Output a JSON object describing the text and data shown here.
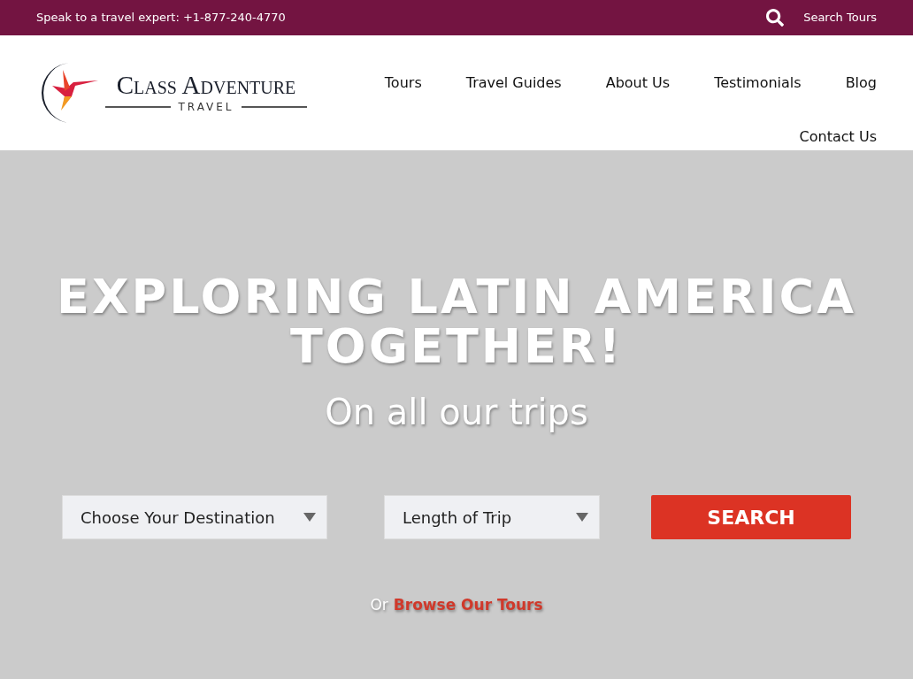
{
  "top_bar": {
    "phone_text": "Speak to a travel expert: +1-877-240-4770",
    "search_label": "Search Tours"
  },
  "logo": {
    "name": "Class Adventure",
    "tagline": "TRAVEL"
  },
  "nav": {
    "items": [
      "Tours",
      "Travel Guides",
      "About Us",
      "Testimonials",
      "Blog",
      "Contact Us"
    ]
  },
  "hero": {
    "headline_line_1": "EXPLORING LATIN AMERICA",
    "headline_line_2": "TOGETHER!",
    "subtitle": "On all our trips",
    "selects": [
      {
        "label": "Choose Your Destination"
      },
      {
        "label": "Length of Trip"
      }
    ],
    "search_button": "SEARCH",
    "browse_prefix": "Or",
    "browse_link": "Browse Our Tours"
  }
}
